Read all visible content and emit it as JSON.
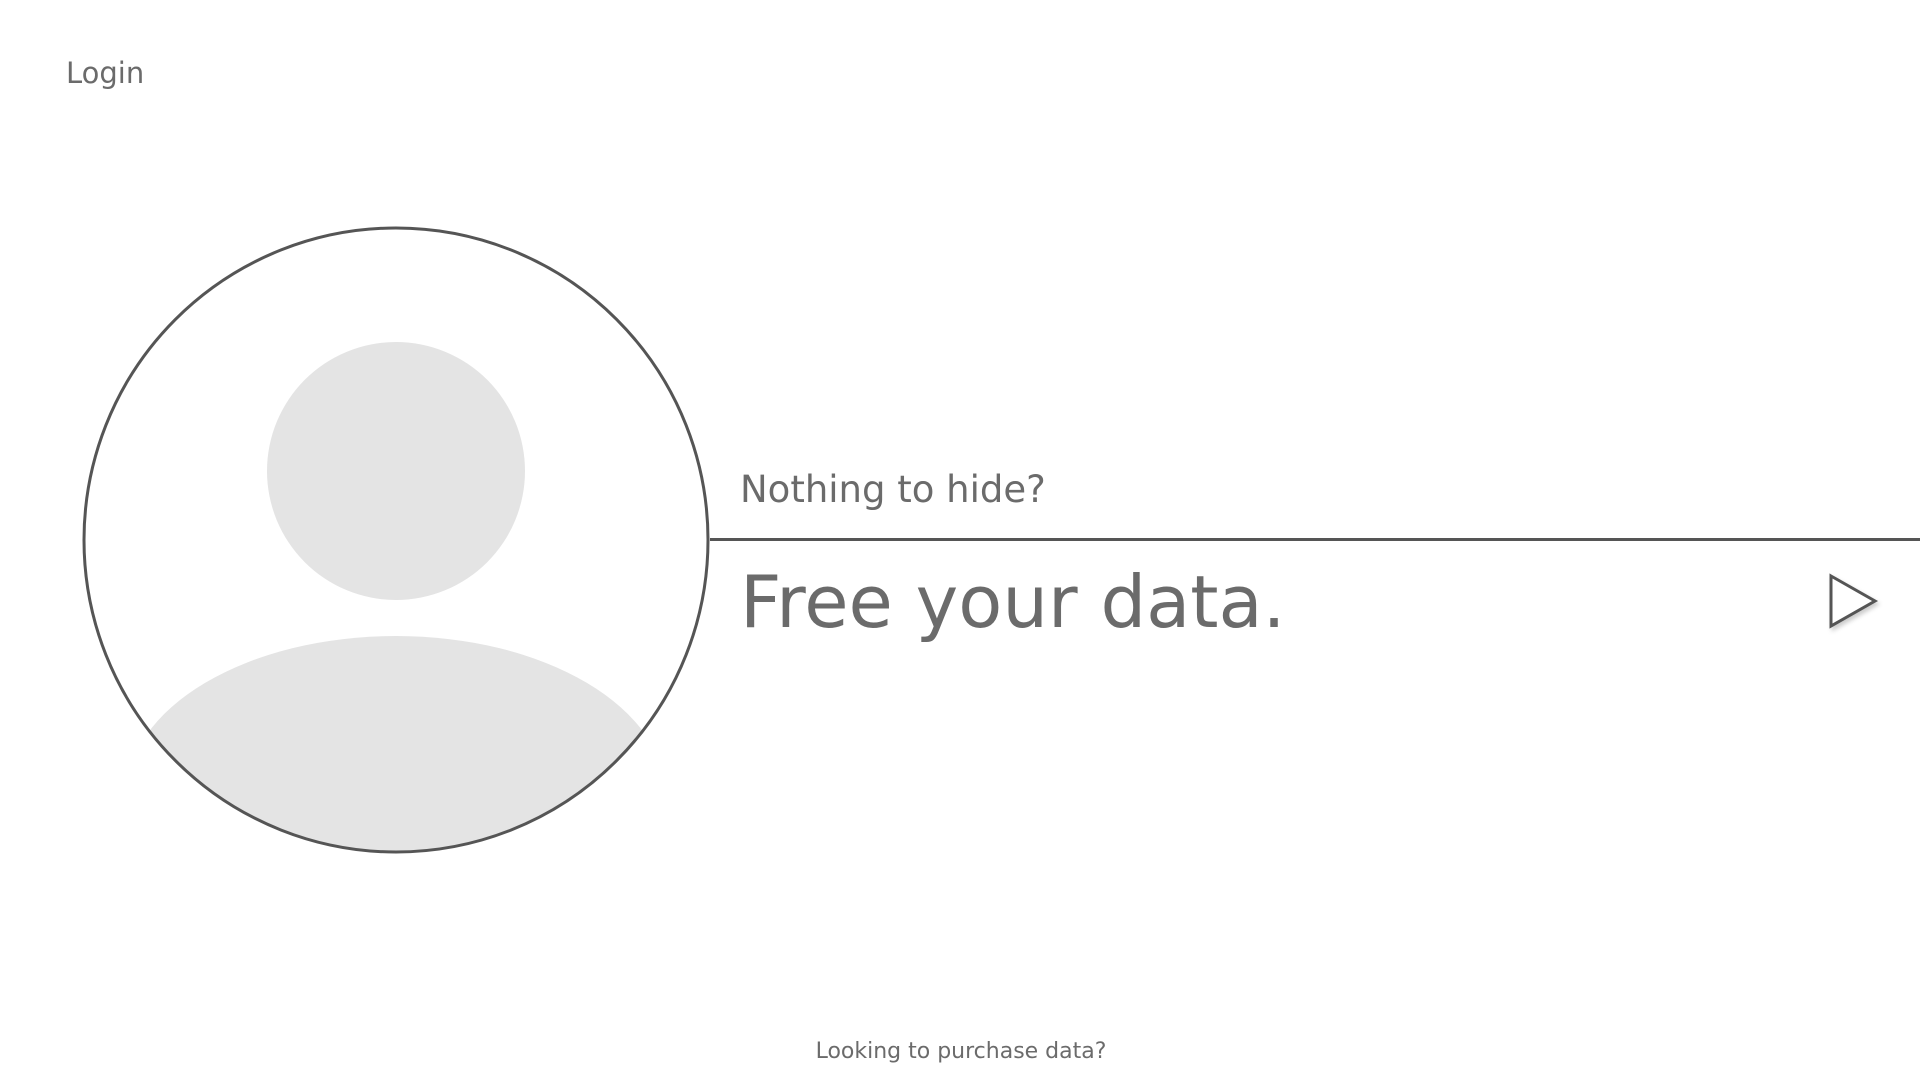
{
  "header": {
    "login_label": "Login"
  },
  "hero": {
    "tagline": "Nothing to hide?",
    "headline": "Free your data."
  },
  "icons": {
    "avatar": "user-avatar-icon",
    "submit": "play-triangle-icon"
  },
  "colors": {
    "text": "#6b6b6b",
    "outline": "#555555",
    "placeholder_fill": "#e4e4e4"
  },
  "footer": {
    "link": "Looking to purchase data?"
  }
}
